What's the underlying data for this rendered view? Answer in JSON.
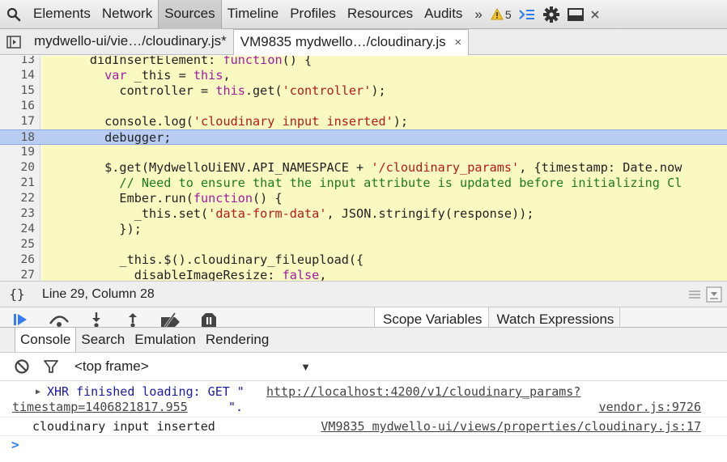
{
  "toolbar": {
    "tabs": [
      "Elements",
      "Network",
      "Sources",
      "Timeline",
      "Profiles",
      "Resources",
      "Audits"
    ],
    "active_tab": "Sources",
    "more": "»",
    "warning_count": "5",
    "icons": [
      "search-icon",
      "warning-icon",
      "console-drawer-icon",
      "gear-icon",
      "dock-icon",
      "close-icon"
    ]
  },
  "file_tabs": [
    {
      "label": "mydwello-ui/vie…/cloudinary.js*"
    },
    {
      "label": "VM9835 mydwello…/cloudinary.js",
      "close": "×"
    }
  ],
  "editor": {
    "lines": [
      {
        "n": "13",
        "text": "      didInsertElement: function() {"
      },
      {
        "n": "14",
        "text": "        var _this = this,"
      },
      {
        "n": "15",
        "text": "          controller = this.get('controller');"
      },
      {
        "n": "16",
        "text": ""
      },
      {
        "n": "17",
        "text": "        console.log('cloudinary input inserted');"
      },
      {
        "n": "18",
        "text": "        debugger;"
      },
      {
        "n": "19",
        "text": ""
      },
      {
        "n": "20",
        "text": "        $.get(MydwelloUiENV.API_NAMESPACE + '/cloudinary_params', {timestamp: Date.now"
      },
      {
        "n": "21",
        "text": "          // Need to ensure that the input attribute is updated before initializing Cl"
      },
      {
        "n": "22",
        "text": "          Ember.run(function() {"
      },
      {
        "n": "23",
        "text": "            _this.set('data-form-data', JSON.stringify(response));"
      },
      {
        "n": "24",
        "text": "          });"
      },
      {
        "n": "25",
        "text": ""
      },
      {
        "n": "26",
        "text": "          _this.$().cloudinary_fileupload({"
      },
      {
        "n": "27",
        "text": "            disableImageResize: false,"
      }
    ],
    "highlighted_line": "18"
  },
  "status": {
    "braces": "{}",
    "position": "Line 29, Column 28"
  },
  "side_tabs": [
    "Scope Variables",
    "Watch Expressions"
  ],
  "drawer_tabs": [
    "Console",
    "Search",
    "Emulation",
    "Rendering"
  ],
  "console_toolbar": {
    "frame": "<top frame>"
  },
  "console": {
    "xhr_prefix": "XHR finished loading: GET \"",
    "xhr_url_part1": "http://localhost:4200/v1/cloudinary_params?",
    "xhr_url_part2": "timestamp=1406821817.955",
    "xhr_suffix": "\".",
    "xhr_source": "vendor.js:9726",
    "log_text": "cloudinary input inserted",
    "log_source": "VM9835 mydwello-ui/views/properties/cloudinary.js:17",
    "prompt": ">"
  }
}
